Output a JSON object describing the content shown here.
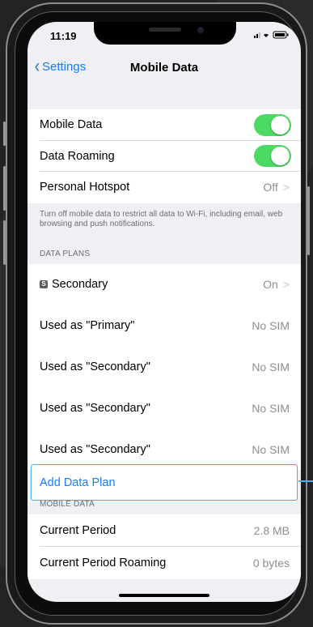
{
  "status_bar": {
    "time": "11:19",
    "icons": "..ıl ᯤ ▬"
  },
  "navbar": {
    "back_label": "Settings",
    "title": "Mobile Data"
  },
  "cellular": {
    "rows": [
      {
        "label": "Mobile Data",
        "toggle": true
      },
      {
        "label": "Data Roaming",
        "toggle": true
      },
      {
        "label": "Personal Hotspot",
        "value": "Off"
      }
    ],
    "footnote": "Turn off mobile data to restrict all data to Wi-Fi, including email, web browsing and push notifications."
  },
  "data_plans": {
    "header": "DATA PLANS",
    "sim_badge": "S",
    "rows": [
      {
        "label": "Secondary",
        "value": "On"
      },
      {
        "label": "Used as \"Primary\"",
        "value": "No SIM"
      },
      {
        "label": "Used as \"Secondary\"",
        "value": "No SIM"
      },
      {
        "label": "Used as \"Secondary\"",
        "value": "No SIM"
      },
      {
        "label": "Used as \"Secondary\"",
        "value": "No SIM"
      }
    ],
    "add_plan_label": "Add Data Plan"
  },
  "mobile_data": {
    "header": "MOBILE DATA",
    "rows": [
      {
        "label": "Current Period",
        "value": "2.8 MB"
      },
      {
        "label": "Current Period Roaming",
        "value": "0 bytes"
      }
    ]
  },
  "colors": {
    "accent": "#157efb",
    "toggle_on": "#4cd964",
    "highlight": "#4aaef0"
  }
}
